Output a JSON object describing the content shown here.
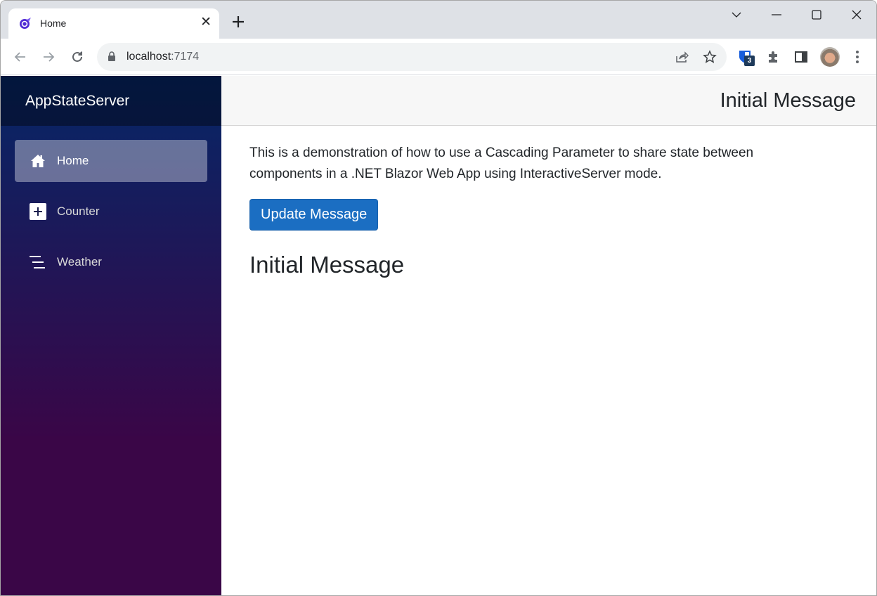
{
  "browser": {
    "tab": {
      "title": "Home",
      "favicon": "blazor-icon"
    },
    "address": {
      "host": "localhost",
      "port": ":7174"
    },
    "extensions": {
      "bitwarden_badge": "3"
    },
    "icons": [
      "back-icon",
      "forward-icon",
      "reload-icon",
      "lock-icon",
      "share-icon",
      "bookmark-star-icon",
      "bitwarden-icon",
      "extensions-puzzle-icon",
      "side-panel-icon",
      "profile-avatar",
      "more-menu-icon",
      "tab-search-icon",
      "minimize-icon",
      "maximize-icon",
      "close-window-icon"
    ]
  },
  "app": {
    "brand": "AppStateServer",
    "nav": [
      {
        "label": "Home",
        "icon": "home-icon",
        "active": true
      },
      {
        "label": "Counter",
        "icon": "plus-square-icon",
        "active": false
      },
      {
        "label": "Weather",
        "icon": "list-icon",
        "active": false
      }
    ],
    "top_row_message": "Initial Message",
    "description": "This is a demonstration of how to use a Cascading Parameter to share state between components in a .NET Blazor Web App using InteractiveServer mode.",
    "update_button": "Update Message",
    "message": "Initial Message"
  },
  "colors": {
    "primary_button": "#1b6ec2",
    "sidebar_top": "#052767",
    "sidebar_bottom": "#3a0647"
  }
}
